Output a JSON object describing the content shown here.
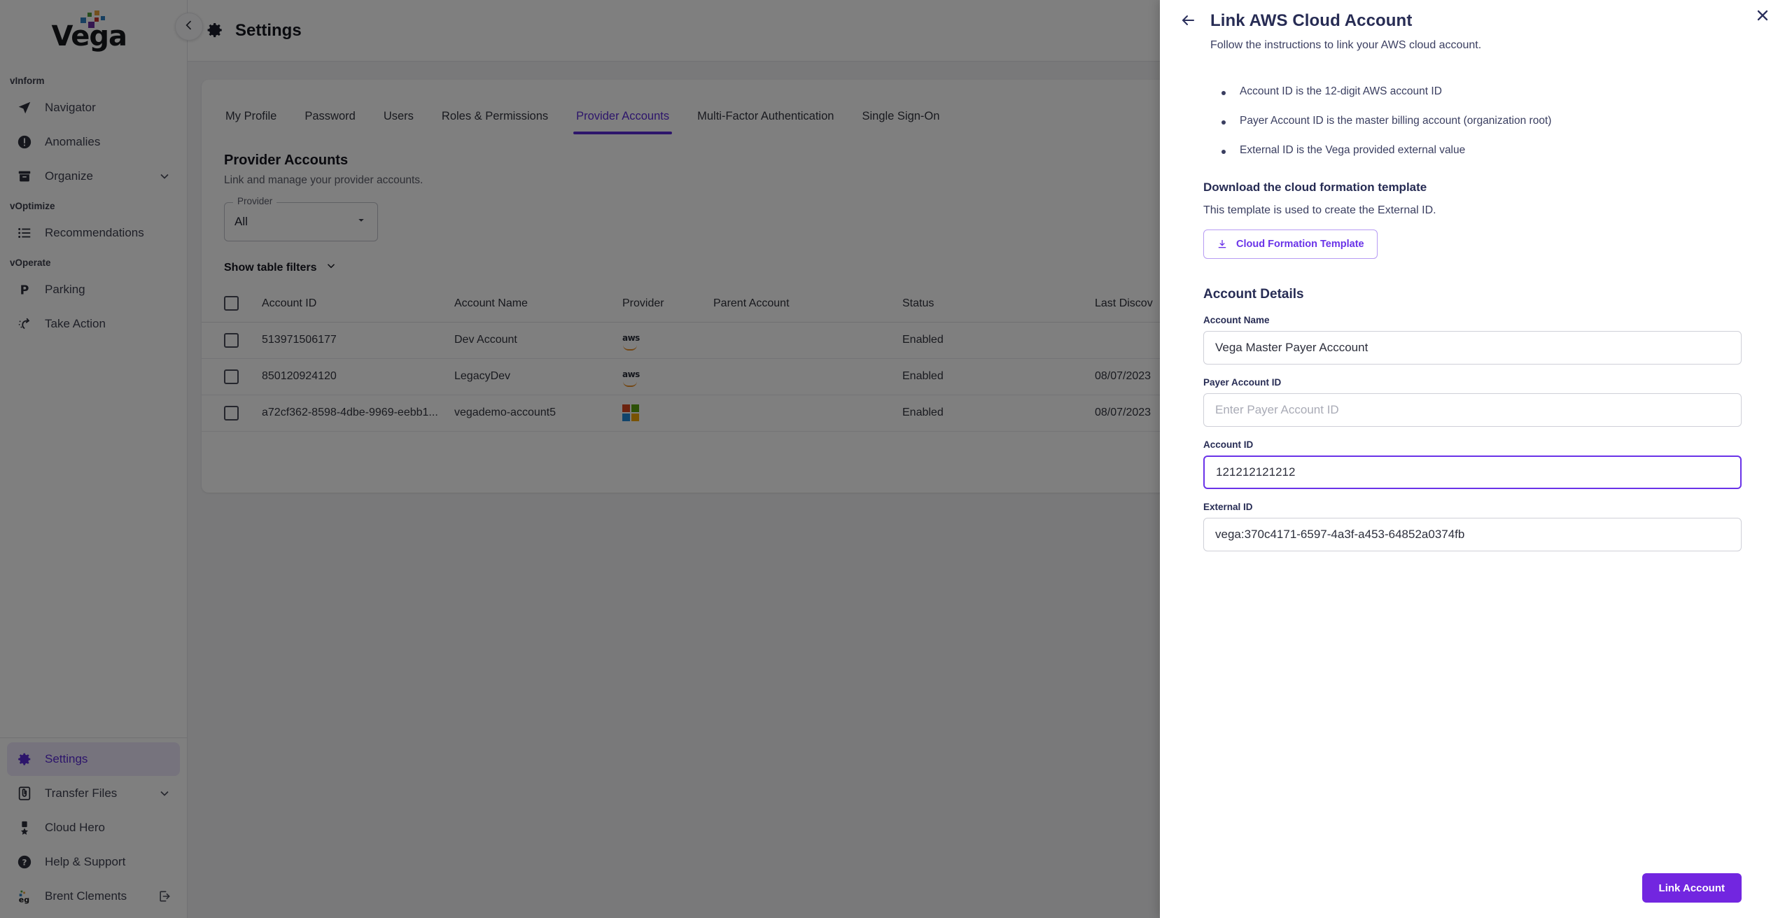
{
  "brand": {
    "name": "Vega",
    "logo_dot_colors": [
      "#2f7fc1",
      "#6b2fa0",
      "#c9342f",
      "#e8a33d",
      "#4f9d3a",
      "#2f7fc1",
      "#8a8f99"
    ]
  },
  "sidebar": {
    "groups": [
      {
        "label": "vInform",
        "items": [
          {
            "label": "Navigator",
            "icon": "navigation-arrow-icon",
            "name": "sidebar-item-navigator",
            "chevron": false,
            "active": false
          },
          {
            "label": "Anomalies",
            "icon": "alert-circle-icon",
            "name": "sidebar-item-anomalies",
            "chevron": false,
            "active": false
          },
          {
            "label": "Organize",
            "icon": "archive-box-icon",
            "name": "sidebar-item-organize",
            "chevron": true,
            "active": false
          }
        ]
      },
      {
        "label": "vOptimize",
        "items": [
          {
            "label": "Recommendations",
            "icon": "list-icon",
            "name": "sidebar-item-recommendations",
            "chevron": false,
            "active": false
          }
        ]
      },
      {
        "label": "vOperate",
        "items": [
          {
            "label": "Parking",
            "icon": "parking-p-icon",
            "name": "sidebar-item-parking",
            "chevron": false,
            "active": false
          },
          {
            "label": "Take Action",
            "icon": "take-action-icon",
            "name": "sidebar-item-take-action",
            "chevron": false,
            "active": false
          }
        ]
      }
    ],
    "bottom_items": [
      {
        "label": "Settings",
        "icon": "gear-icon",
        "name": "sidebar-item-settings",
        "chevron": false,
        "active": true
      },
      {
        "label": "Transfer Files",
        "icon": "paperclip-document-icon",
        "name": "sidebar-item-transfer-files",
        "chevron": true,
        "active": false
      },
      {
        "label": "Cloud Hero",
        "icon": "medal-icon",
        "name": "sidebar-item-cloud-hero",
        "chevron": false,
        "active": false
      },
      {
        "label": "Help & Support",
        "icon": "question-circle-icon",
        "name": "sidebar-item-help-support",
        "chevron": false,
        "active": false
      }
    ],
    "user": {
      "label": "Brent Clements",
      "icon": "user-avatar",
      "logout_icon": "logout-icon"
    },
    "collapse_icon": "chevron-left-icon"
  },
  "topbar": {
    "title": "Settings",
    "icon": "gear-icon"
  },
  "tabs": [
    {
      "label": "My Profile",
      "name": "tab-my-profile",
      "active": false
    },
    {
      "label": "Password",
      "name": "tab-password",
      "active": false
    },
    {
      "label": "Users",
      "name": "tab-users",
      "active": false
    },
    {
      "label": "Roles & Permissions",
      "name": "tab-roles-permissions",
      "active": false
    },
    {
      "label": "Provider Accounts",
      "name": "tab-provider-accounts",
      "active": true
    },
    {
      "label": "Multi-Factor Authentication",
      "name": "tab-multi-factor-authentication",
      "active": false
    },
    {
      "label": "Single Sign-On",
      "name": "tab-single-sign-on",
      "active": false
    }
  ],
  "page": {
    "title": "Provider Accounts",
    "subtitle": "Link and manage your provider accounts.",
    "provider_filter": {
      "legend": "Provider",
      "value": "All",
      "caret_icon": "caret-down-icon"
    },
    "filters_toggle": {
      "label": "Show table filters",
      "icon": "chevron-down-icon"
    }
  },
  "table": {
    "columns": [
      "Account ID",
      "Account Name",
      "Provider",
      "Parent Account",
      "Status",
      "Last Discov"
    ],
    "rows": [
      {
        "account_id": "513971506177",
        "account_name": "Dev Account",
        "provider": "aws",
        "parent_account": "",
        "status": "Enabled",
        "last_discovery": ""
      },
      {
        "account_id": "850120924120",
        "account_name": "LegacyDev",
        "provider": "aws",
        "parent_account": "",
        "status": "Enabled",
        "last_discovery": "08/07/2023"
      },
      {
        "account_id": "a72cf362-8598-4dbe-9969-eebb1...",
        "account_name": "vegademo-account5",
        "provider": "azure",
        "parent_account": "",
        "status": "Enabled",
        "last_discovery": "08/07/2023"
      }
    ]
  },
  "drawer": {
    "title": "Link AWS Cloud Account",
    "subtitle": "Follow the instructions to link your AWS cloud account.",
    "back_icon": "arrow-left-icon",
    "close_icon": "close-icon",
    "bullets": [
      "Account ID is the 12-digit AWS account ID",
      "Payer Account ID is the master billing account (organization root)",
      "External ID is the Vega provided external value"
    ],
    "template_section": {
      "title": "Download the cloud formation template",
      "subtitle": "This template is used to create the External ID.",
      "button_label": "Cloud Formation Template",
      "button_icon": "download-icon"
    },
    "account_details_title": "Account Details",
    "fields": [
      {
        "label": "Account Name",
        "value": "Vega Master Payer Acccount",
        "placeholder": "",
        "focused": false,
        "name": "account-name-field"
      },
      {
        "label": "Payer Account ID",
        "value": "",
        "placeholder": "Enter Payer Account ID",
        "focused": false,
        "name": "payer-account-id-field"
      },
      {
        "label": "Account ID",
        "value": "121212121212",
        "placeholder": "",
        "focused": true,
        "name": "account-id-field"
      },
      {
        "label": "External ID",
        "value": "vega:370c4171-6597-4a3f-a453-64852a0374fb",
        "placeholder": "",
        "focused": false,
        "name": "external-id-field"
      }
    ],
    "submit_label": "Link Account"
  },
  "colors": {
    "accent": "#6a33e8",
    "primary_button": "#7226e0",
    "drawer_text": "#272c54",
    "active_tab": "#5b2bd6"
  }
}
